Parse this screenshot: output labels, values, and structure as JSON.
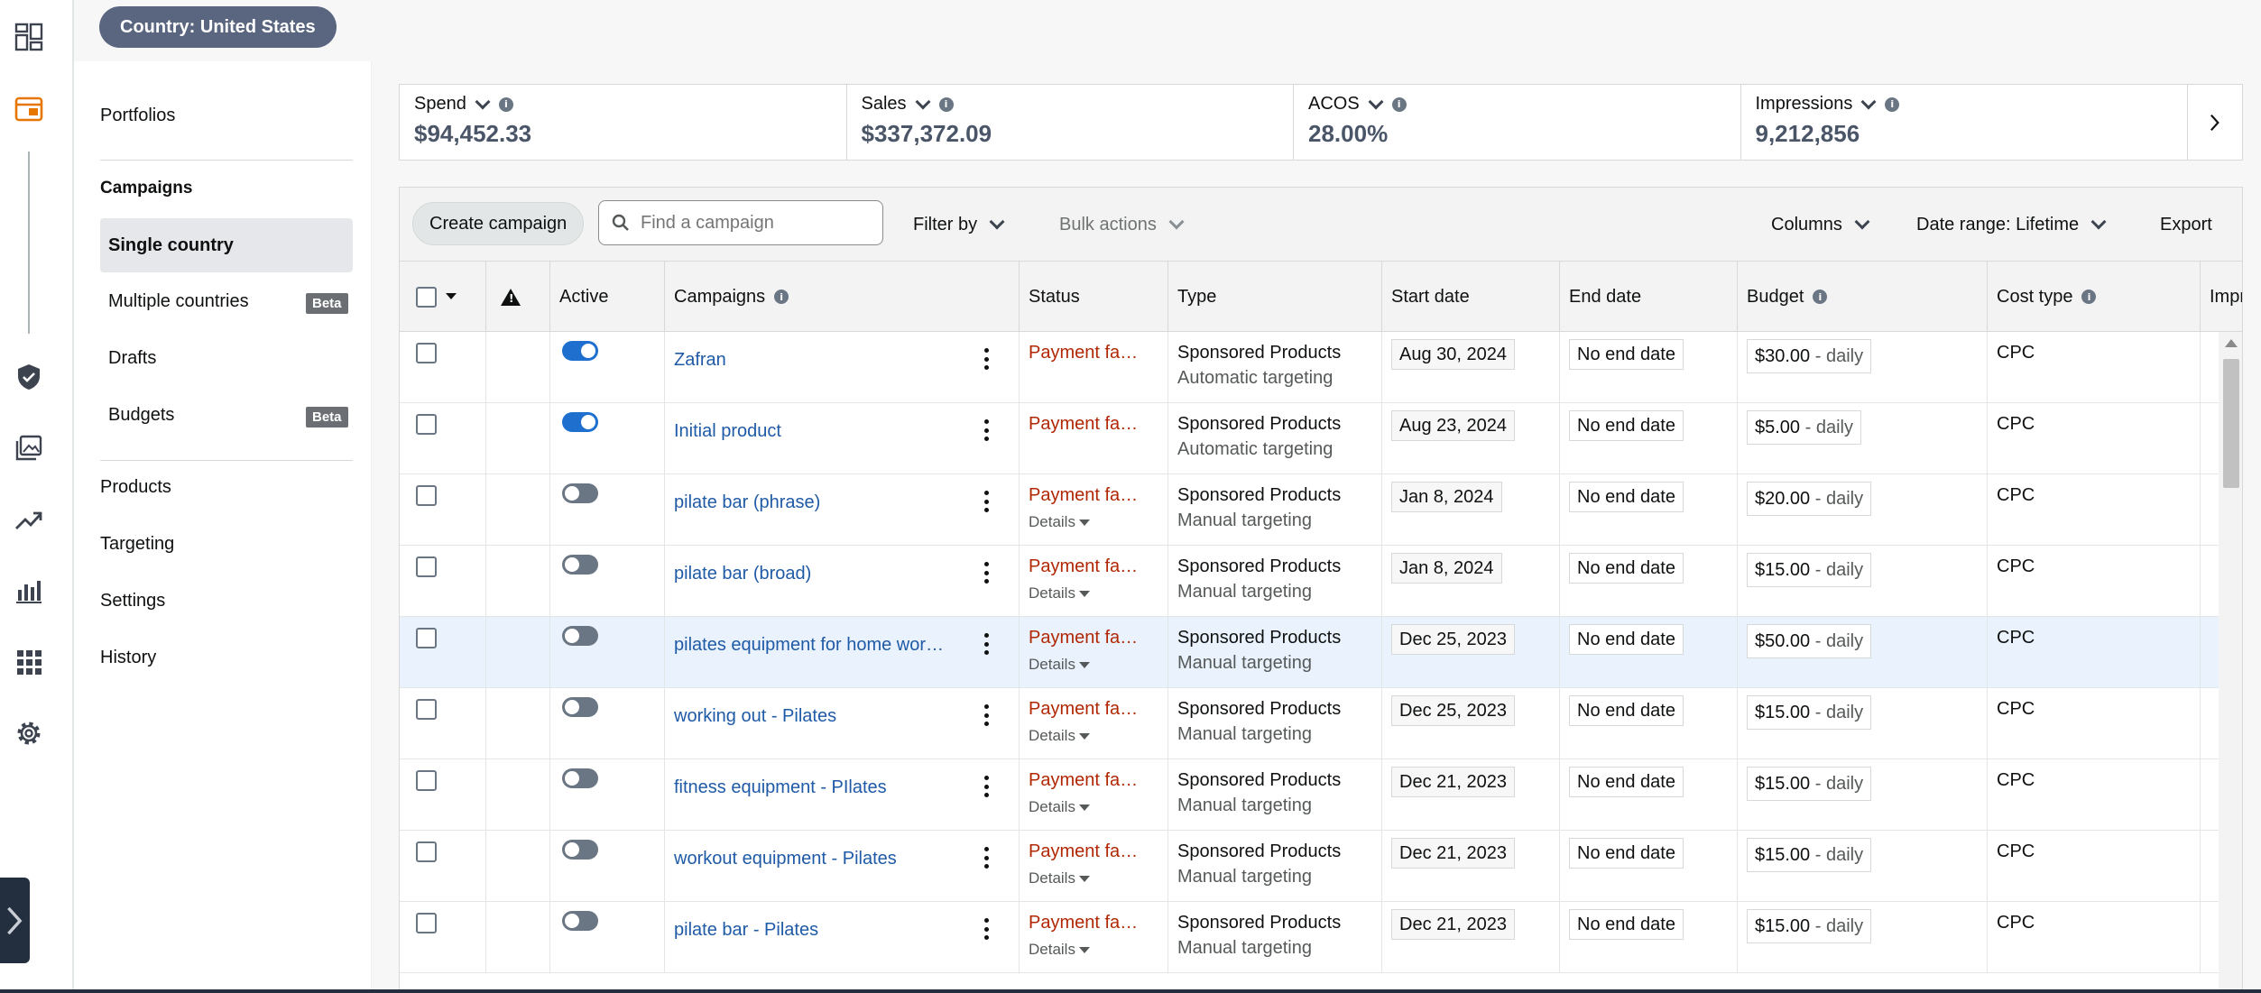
{
  "header": {
    "country_label": "Country: United States"
  },
  "subnav": {
    "portfolios": "Portfolios",
    "campaigns_heading": "Campaigns",
    "single_country": "Single country",
    "multiple_countries": "Multiple countries",
    "drafts": "Drafts",
    "budgets": "Budgets",
    "beta": "Beta",
    "products": "Products",
    "targeting": "Targeting",
    "settings": "Settings",
    "history": "History"
  },
  "metrics": [
    {
      "label": "Spend",
      "value": "$94,452.33"
    },
    {
      "label": "Sales",
      "value": "$337,372.09"
    },
    {
      "label": "ACOS",
      "value": "28.00%"
    },
    {
      "label": "Impressions",
      "value": "9,212,856"
    }
  ],
  "toolbar": {
    "create_campaign": "Create campaign",
    "search_placeholder": "Find a campaign",
    "filter_by": "Filter by",
    "bulk_actions": "Bulk actions",
    "columns": "Columns",
    "date_range": "Date range: Lifetime",
    "export": "Export"
  },
  "columns": {
    "active": "Active",
    "campaigns": "Campaigns",
    "status": "Status",
    "type": "Type",
    "start_date": "Start date",
    "end_date": "End date",
    "budget": "Budget",
    "cost_type": "Cost type",
    "impressions": "Impres"
  },
  "rows": [
    {
      "active": true,
      "name": "Zafran",
      "status": "Payment fa…",
      "details": "",
      "type": "Sponsored Products",
      "targeting": "Automatic targeting",
      "start": "Aug 30, 2024",
      "end": "No end date",
      "budget": "$30.00",
      "budget_period": " - daily",
      "cost": "CPC"
    },
    {
      "active": true,
      "name": "Initial product",
      "status": "Payment fa…",
      "details": "",
      "type": "Sponsored Products",
      "targeting": "Automatic targeting",
      "start": "Aug 23, 2024",
      "end": "No end date",
      "budget": "$5.00",
      "budget_period": " - daily",
      "cost": "CPC"
    },
    {
      "active": false,
      "name": "pilate bar (phrase)",
      "status": "Payment fa…",
      "details": "Details",
      "type": "Sponsored Products",
      "targeting": "Manual targeting",
      "start": "Jan 8, 2024",
      "end": "No end date",
      "budget": "$20.00",
      "budget_period": " - daily",
      "cost": "CPC"
    },
    {
      "active": false,
      "name": "pilate bar (broad)",
      "status": "Payment fa…",
      "details": "Details",
      "type": "Sponsored Products",
      "targeting": "Manual targeting",
      "start": "Jan 8, 2024",
      "end": "No end date",
      "budget": "$15.00",
      "budget_period": " - daily",
      "cost": "CPC"
    },
    {
      "active": false,
      "name": "pilates equipment for home work…",
      "status": "Payment fa…",
      "details": "Details",
      "type": "Sponsored Products",
      "targeting": "Manual targeting",
      "start": "Dec 25, 2023",
      "end": "No end date",
      "budget": "$50.00",
      "budget_period": " - daily",
      "cost": "CPC",
      "highlight": true
    },
    {
      "active": false,
      "name": "working out - Pilates",
      "status": "Payment fa…",
      "details": "Details",
      "type": "Sponsored Products",
      "targeting": "Manual targeting",
      "start": "Dec 25, 2023",
      "end": "No end date",
      "budget": "$15.00",
      "budget_period": " - daily",
      "cost": "CPC"
    },
    {
      "active": false,
      "name": "fitness equipment - PIlates",
      "status": "Payment fa…",
      "details": "Details",
      "type": "Sponsored Products",
      "targeting": "Manual targeting",
      "start": "Dec 21, 2023",
      "end": "No end date",
      "budget": "$15.00",
      "budget_period": " - daily",
      "cost": "CPC"
    },
    {
      "active": false,
      "name": "workout equipment - Pilates",
      "status": "Payment fa…",
      "details": "Details",
      "type": "Sponsored Products",
      "targeting": "Manual targeting",
      "start": "Dec 21, 2023",
      "end": "No end date",
      "budget": "$15.00",
      "budget_period": " - daily",
      "cost": "CPC"
    },
    {
      "active": false,
      "name": "pilate bar - Pilates",
      "status": "Payment fa…",
      "details": "Details",
      "type": "Sponsored Products",
      "targeting": "Manual targeting",
      "start": "Dec 21, 2023",
      "end": "No end date",
      "budget": "$15.00",
      "budget_period": " - daily",
      "cost": "CPC"
    }
  ],
  "colors": {
    "accent_orange": "#e77600",
    "link_blue": "#1f5aa6",
    "error_red": "#b12704",
    "toggle_on": "#1f6fcf"
  },
  "icons": [
    "dashboard-icon",
    "campaign-manager-icon",
    "brand-protection-icon",
    "media-icon",
    "trending-icon",
    "reports-icon",
    "apps-grid-icon",
    "settings-gear-icon",
    "expand-chevron-icon"
  ]
}
